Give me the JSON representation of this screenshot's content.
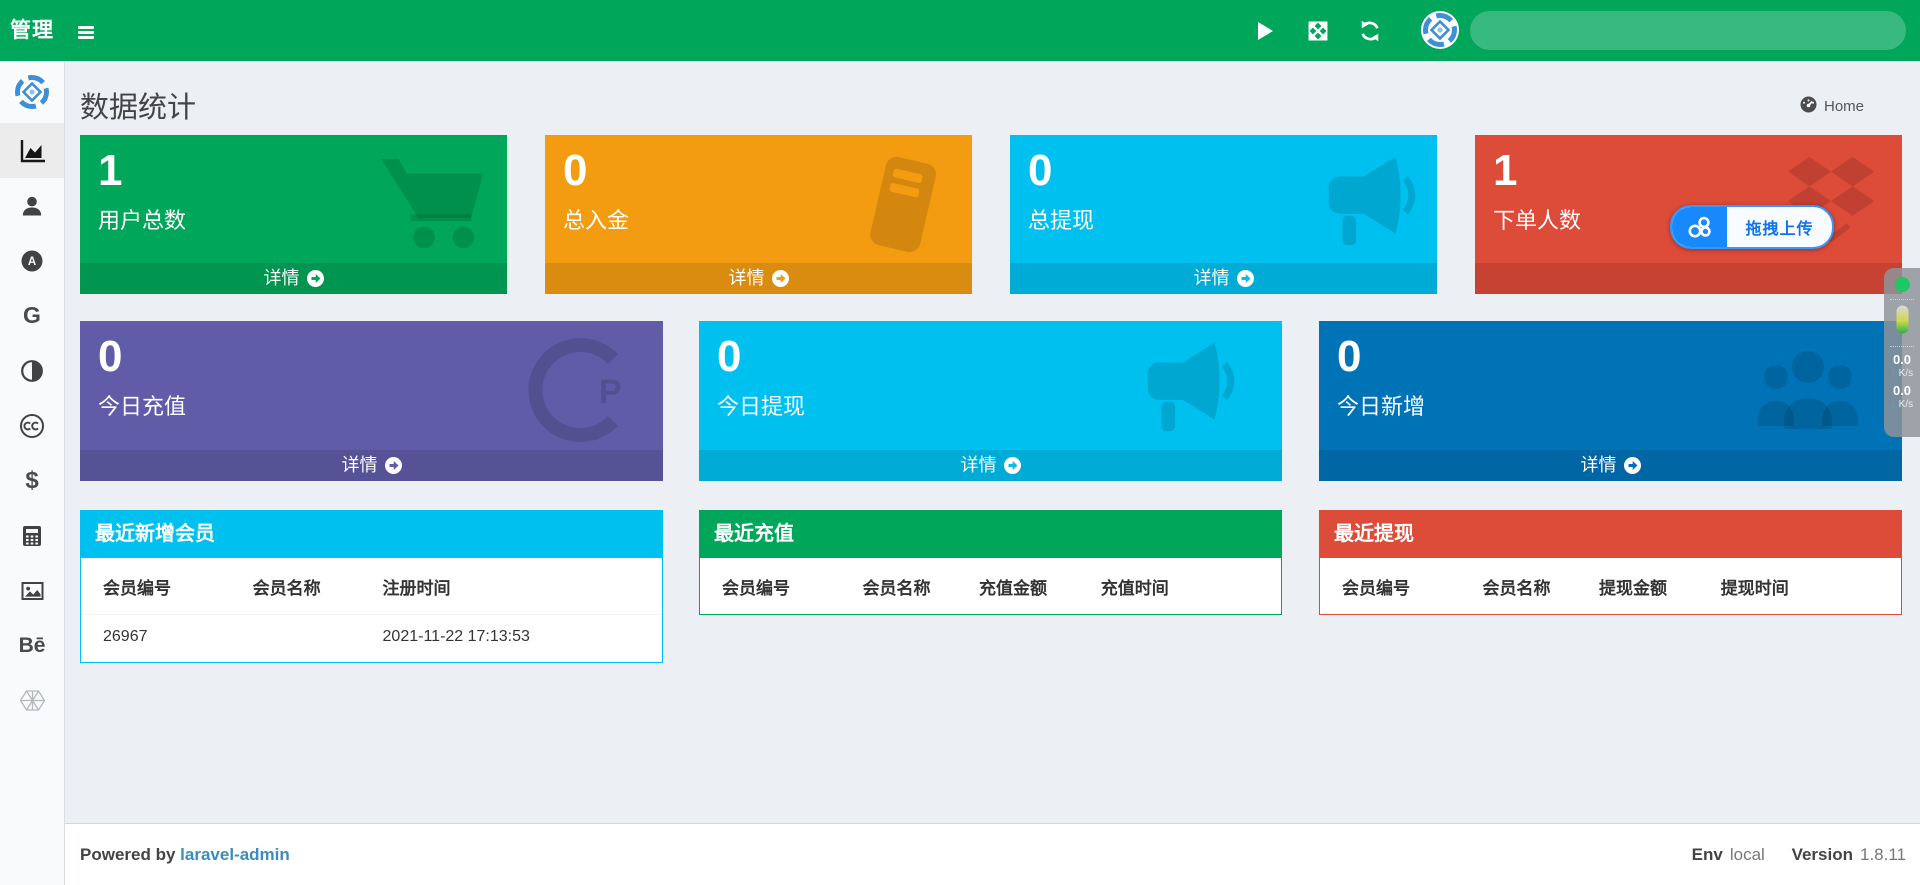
{
  "colors": {
    "navbar": "#00a65a",
    "green": "#00a65a",
    "orange": "#f39c12",
    "aqua": "#00c0ef",
    "red": "#dd4b39",
    "purple": "#605ca8",
    "blue": "#0073b7",
    "sidebar_bg": "#f9fafc",
    "content_bg": "#ecf0f5",
    "link": "#3c8dbc"
  },
  "navbar": {
    "brand": "管理",
    "icons": [
      "play-icon",
      "fullscreen-icon",
      "refresh-icon",
      "avatar-logo"
    ],
    "search_value": ""
  },
  "sidebar": {
    "items": [
      {
        "icon": "app-logo-icon"
      },
      {
        "icon": "area-chart-icon",
        "active": true
      },
      {
        "icon": "user-icon"
      },
      {
        "icon": "a-circle-icon"
      },
      {
        "icon": "google-g-icon",
        "text": "G"
      },
      {
        "icon": "contrast-icon"
      },
      {
        "icon": "creative-commons-icon"
      },
      {
        "icon": "dollar-icon",
        "text": "$"
      },
      {
        "icon": "calculator-icon"
      },
      {
        "icon": "image-icon"
      },
      {
        "icon": "behance-icon",
        "text": "Bē"
      },
      {
        "icon": "hexagon-lattice-icon"
      }
    ],
    "google_g": "G",
    "dollar": "$",
    "behance": "Bē"
  },
  "page": {
    "title": "数据统计",
    "breadcrumb_home": "Home"
  },
  "stat_cards": [
    {
      "value": "1",
      "label": "用户总数",
      "detail_label": "详情",
      "color": "#00a65a",
      "icon": "shopping-cart"
    },
    {
      "value": "0",
      "label": "总入金",
      "detail_label": "详情",
      "color": "#f39c12",
      "icon": "book"
    },
    {
      "value": "0",
      "label": "总提现",
      "detail_label": "详情",
      "color": "#00c0ef",
      "icon": "bullhorn"
    },
    {
      "value": "1",
      "label": "下单人数",
      "detail_label": "",
      "color": "#dd4b39",
      "icon": "dropbox"
    },
    {
      "value": "0",
      "label": "今日充值",
      "detail_label": "详情",
      "color": "#605ca8",
      "icon": "cp-circle"
    },
    {
      "value": "0",
      "label": "今日提现",
      "detail_label": "详情",
      "color": "#00c0ef",
      "icon": "bullhorn"
    },
    {
      "value": "0",
      "label": "今日新增",
      "detail_label": "详情",
      "color": "#0073b7",
      "icon": "users"
    }
  ],
  "panels": [
    {
      "title": "最近新增会员",
      "color": "#00c0ef",
      "columns": [
        "会员编号",
        "会员名称",
        "注册时间"
      ],
      "rows": [
        [
          "26967",
          "",
          "2021-11-22 17:13:53"
        ]
      ]
    },
    {
      "title": "最近充值",
      "color": "#00a65a",
      "columns": [
        "会员编号",
        "会员名称",
        "充值金额",
        "充值时间"
      ],
      "rows": []
    },
    {
      "title": "最近提现",
      "color": "#dd4b39",
      "columns": [
        "会员编号",
        "会员名称",
        "提现金额",
        "提现时间"
      ],
      "rows": []
    }
  ],
  "upload_overlay": {
    "label": "拖拽上传"
  },
  "speed_widget": {
    "up_value": "0.0",
    "up_unit": "K/s",
    "down_value": "0.0",
    "down_unit": "K/s"
  },
  "footer": {
    "powered_by": "Powered by",
    "link_label": "laravel-admin",
    "env_label": "Env",
    "env_value": "local",
    "version_label": "Version",
    "version_value": "1.8.11"
  }
}
